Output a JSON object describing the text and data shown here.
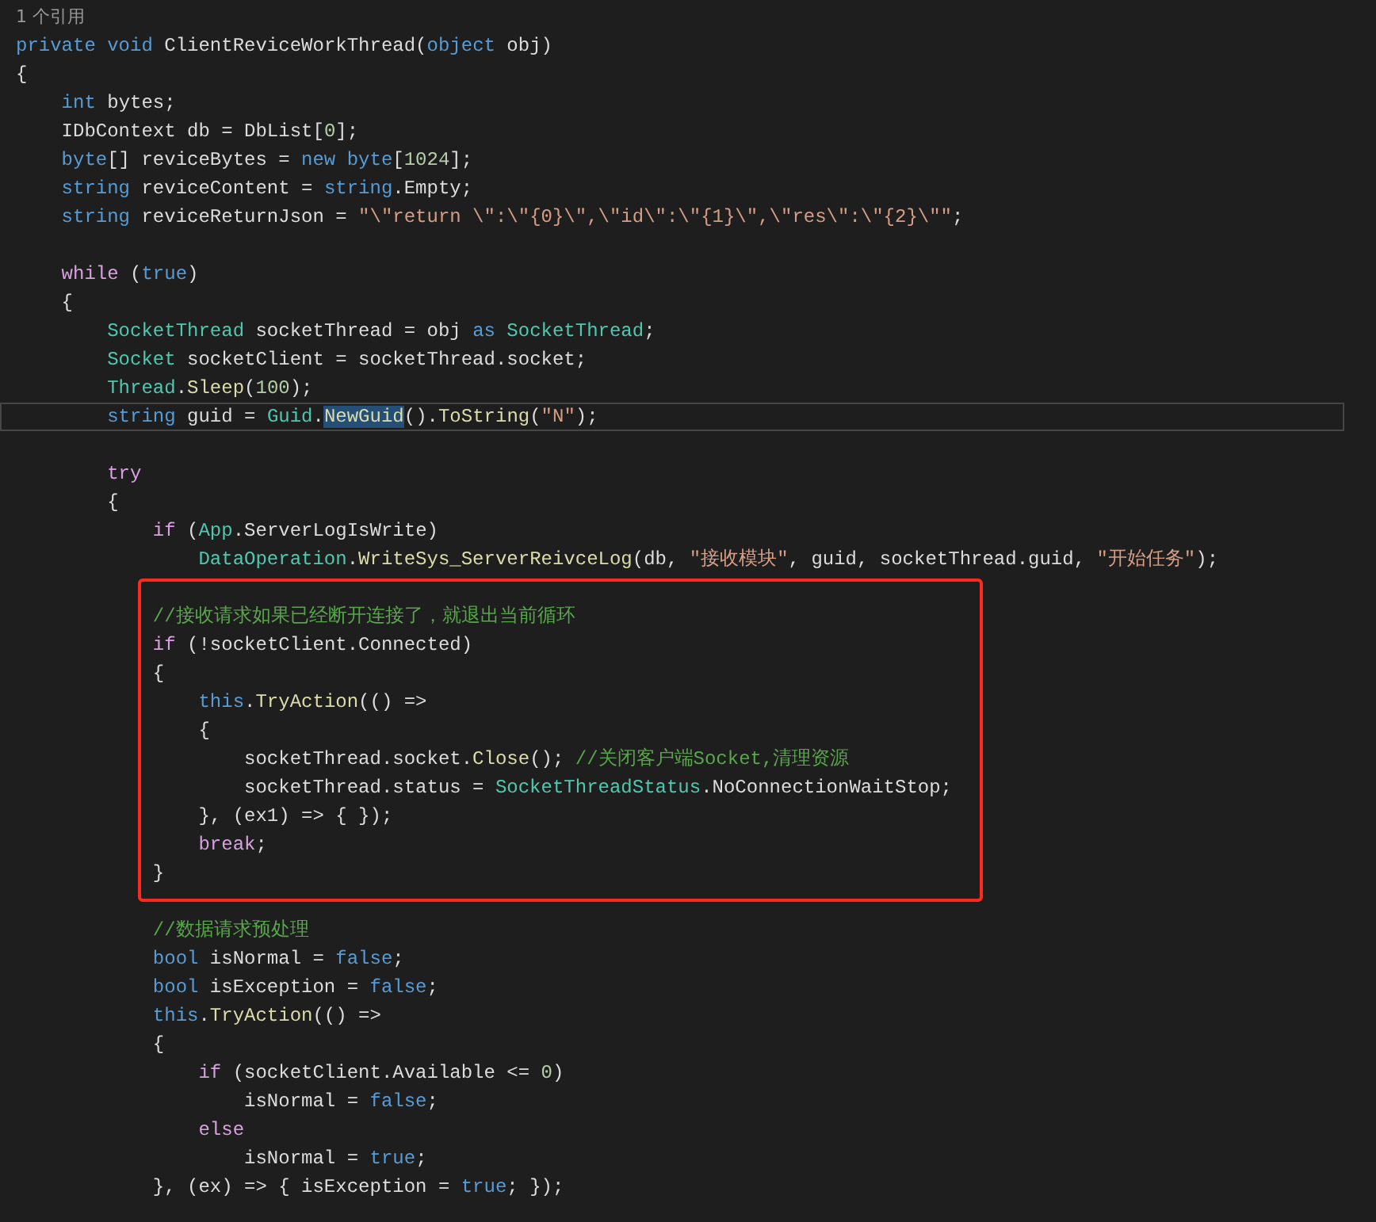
{
  "codelens": "1 个引用",
  "blocks": [
    {
      "framed": false,
      "lines": [
        {
          "kind": "code",
          "tokens": [
            {
              "kind": "kw",
              "text": "private void "
            },
            {
              "kind": "plain",
              "text": "ClientReviceWorkThread("
            },
            {
              "kind": "kw",
              "text": "object"
            },
            {
              "kind": "plain",
              "text": " obj)"
            }
          ]
        },
        {
          "kind": "code",
          "tokens": [
            {
              "kind": "plain",
              "text": "{"
            }
          ]
        },
        {
          "kind": "code",
          "tokens": [
            {
              "kind": "kw",
              "text": "    int"
            },
            {
              "kind": "plain",
              "text": " bytes;"
            }
          ]
        },
        {
          "kind": "code",
          "tokens": [
            {
              "kind": "plain",
              "text": "    IDbContext db = DbList["
            },
            {
              "kind": "num",
              "text": "0"
            },
            {
              "kind": "plain",
              "text": "];"
            }
          ]
        },
        {
          "kind": "code",
          "tokens": [
            {
              "kind": "kw",
              "text": "    byte"
            },
            {
              "kind": "plain",
              "text": "[] reviceBytes = "
            },
            {
              "kind": "kw",
              "text": "new byte"
            },
            {
              "kind": "plain",
              "text": "["
            },
            {
              "kind": "num",
              "text": "1024"
            },
            {
              "kind": "plain",
              "text": "];"
            }
          ]
        },
        {
          "kind": "code",
          "tokens": [
            {
              "kind": "kw",
              "text": "    string"
            },
            {
              "kind": "plain",
              "text": " reviceContent = "
            },
            {
              "kind": "kw",
              "text": "string"
            },
            {
              "kind": "plain",
              "text": ".Empty;"
            }
          ]
        },
        {
          "kind": "code",
          "tokens": [
            {
              "kind": "kw",
              "text": "    string"
            },
            {
              "kind": "plain",
              "text": " reviceReturnJson = "
            },
            {
              "kind": "str",
              "text": "\"\\\"return \\\":\\\"{0}\\\",\\\"id\\\":\\\"{1}\\\",\\\"res\\\":\\\"{2}\\\"\""
            },
            {
              "kind": "plain",
              "text": ";"
            }
          ]
        },
        {
          "kind": "blank"
        },
        {
          "kind": "code",
          "tokens": [
            {
              "kind": "ctl",
              "text": "    while"
            },
            {
              "kind": "plain",
              "text": " ("
            },
            {
              "kind": "kw",
              "text": "true"
            },
            {
              "kind": "plain",
              "text": ")"
            }
          ]
        },
        {
          "kind": "code",
          "tokens": [
            {
              "kind": "plain",
              "text": "    {"
            }
          ]
        },
        {
          "kind": "code",
          "tokens": [
            {
              "kind": "type",
              "text": "        SocketThread"
            },
            {
              "kind": "plain",
              "text": " socketThread = obj "
            },
            {
              "kind": "kw",
              "text": "as "
            },
            {
              "kind": "type",
              "text": "SocketThread"
            },
            {
              "kind": "plain",
              "text": ";"
            }
          ]
        },
        {
          "kind": "code",
          "tokens": [
            {
              "kind": "type",
              "text": "        Socket"
            },
            {
              "kind": "plain",
              "text": " socketClient = socketThread.socket;"
            }
          ]
        },
        {
          "kind": "code",
          "tokens": [
            {
              "kind": "type",
              "text": "        Thread"
            },
            {
              "kind": "plain",
              "text": "."
            },
            {
              "kind": "fn",
              "text": "Sleep"
            },
            {
              "kind": "plain",
              "text": "("
            },
            {
              "kind": "num",
              "text": "100"
            },
            {
              "kind": "plain",
              "text": ");"
            }
          ]
        },
        {
          "kind": "current",
          "tokens": [
            {
              "kind": "kw",
              "text": "        string"
            },
            {
              "kind": "plain",
              "text": " guid = "
            },
            {
              "kind": "type",
              "text": "Guid"
            },
            {
              "kind": "plain",
              "text": "."
            },
            {
              "kind": "selection",
              "text": "NewGuid"
            },
            {
              "kind": "plain",
              "text": "()."
            },
            {
              "kind": "fn",
              "text": "ToString"
            },
            {
              "kind": "plain",
              "text": "("
            },
            {
              "kind": "str",
              "text": "\"N\""
            },
            {
              "kind": "plain",
              "text": ");"
            }
          ]
        },
        {
          "kind": "blank"
        },
        {
          "kind": "code",
          "tokens": [
            {
              "kind": "ctl",
              "text": "        try"
            }
          ]
        },
        {
          "kind": "code",
          "tokens": [
            {
              "kind": "plain",
              "text": "        {"
            }
          ]
        },
        {
          "kind": "code",
          "tokens": [
            {
              "kind": "ctl",
              "text": "            if"
            },
            {
              "kind": "plain",
              "text": " ("
            },
            {
              "kind": "type",
              "text": "App"
            },
            {
              "kind": "plain",
              "text": ".ServerLogIsWrite)"
            }
          ]
        },
        {
          "kind": "code",
          "tokens": [
            {
              "kind": "type",
              "text": "                DataOperation"
            },
            {
              "kind": "plain",
              "text": "."
            },
            {
              "kind": "fn",
              "text": "WriteSys_ServerReivceLog"
            },
            {
              "kind": "plain",
              "text": "(db, "
            },
            {
              "kind": "str",
              "text": "\"接收模块\""
            },
            {
              "kind": "plain",
              "text": ", guid, socketThread.guid, "
            },
            {
              "kind": "str",
              "text": "\"开始任务\""
            },
            {
              "kind": "plain",
              "text": ");"
            }
          ]
        }
      ]
    },
    {
      "framed": true,
      "lines": [
        {
          "kind": "blank"
        },
        {
          "kind": "code",
          "tokens": [
            {
              "kind": "cmt",
              "text": "            //接收请求如果已经断开连接了，就退出当前循环"
            }
          ]
        },
        {
          "kind": "code",
          "tokens": [
            {
              "kind": "ctl",
              "text": "            if"
            },
            {
              "kind": "plain",
              "text": " (!socketClient.Connected)"
            }
          ]
        },
        {
          "kind": "code",
          "tokens": [
            {
              "kind": "plain",
              "text": "            {"
            }
          ]
        },
        {
          "kind": "code",
          "tokens": [
            {
              "kind": "kw",
              "text": "                this"
            },
            {
              "kind": "plain",
              "text": "."
            },
            {
              "kind": "fn",
              "text": "TryAction"
            },
            {
              "kind": "plain",
              "text": "(() =>"
            }
          ]
        },
        {
          "kind": "code",
          "tokens": [
            {
              "kind": "plain",
              "text": "                {"
            }
          ]
        },
        {
          "kind": "code",
          "tokens": [
            {
              "kind": "plain",
              "text": "                    socketThread.socket."
            },
            {
              "kind": "fn",
              "text": "Close"
            },
            {
              "kind": "plain",
              "text": "(); "
            },
            {
              "kind": "cmt",
              "text": "//关闭客户端Socket,清理资源"
            }
          ]
        },
        {
          "kind": "code",
          "tokens": [
            {
              "kind": "plain",
              "text": "                    socketThread.status = "
            },
            {
              "kind": "type",
              "text": "SocketThreadStatus"
            },
            {
              "kind": "plain",
              "text": ".NoConnectionWaitStop;"
            }
          ]
        },
        {
          "kind": "code",
          "tokens": [
            {
              "kind": "plain",
              "text": "                }, (ex1) => { });"
            }
          ]
        },
        {
          "kind": "code",
          "tokens": [
            {
              "kind": "ctl",
              "text": "                break"
            },
            {
              "kind": "plain",
              "text": ";"
            }
          ]
        },
        {
          "kind": "code",
          "tokens": [
            {
              "kind": "plain",
              "text": "            }"
            }
          ]
        }
      ]
    },
    {
      "framed": false,
      "lines": [
        {
          "kind": "blank"
        },
        {
          "kind": "code",
          "tokens": [
            {
              "kind": "cmt",
              "text": "            //数据请求预处理"
            }
          ]
        },
        {
          "kind": "code",
          "tokens": [
            {
              "kind": "kw",
              "text": "            bool"
            },
            {
              "kind": "plain",
              "text": " isNormal = "
            },
            {
              "kind": "kw",
              "text": "false"
            },
            {
              "kind": "plain",
              "text": ";"
            }
          ]
        },
        {
          "kind": "code",
          "tokens": [
            {
              "kind": "kw",
              "text": "            bool"
            },
            {
              "kind": "plain",
              "text": " isException = "
            },
            {
              "kind": "kw",
              "text": "false"
            },
            {
              "kind": "plain",
              "text": ";"
            }
          ]
        },
        {
          "kind": "code",
          "tokens": [
            {
              "kind": "kw",
              "text": "            this"
            },
            {
              "kind": "plain",
              "text": "."
            },
            {
              "kind": "fn",
              "text": "TryAction"
            },
            {
              "kind": "plain",
              "text": "(() =>"
            }
          ]
        },
        {
          "kind": "code",
          "tokens": [
            {
              "kind": "plain",
              "text": "            {"
            }
          ]
        },
        {
          "kind": "code",
          "tokens": [
            {
              "kind": "ctl",
              "text": "                if"
            },
            {
              "kind": "plain",
              "text": " (socketClient.Available <= "
            },
            {
              "kind": "num",
              "text": "0"
            },
            {
              "kind": "plain",
              "text": ")"
            }
          ]
        },
        {
          "kind": "code",
          "tokens": [
            {
              "kind": "plain",
              "text": "                    isNormal = "
            },
            {
              "kind": "kw",
              "text": "false"
            },
            {
              "kind": "plain",
              "text": ";"
            }
          ]
        },
        {
          "kind": "code",
          "tokens": [
            {
              "kind": "ctl",
              "text": "                else"
            }
          ]
        },
        {
          "kind": "code",
          "tokens": [
            {
              "kind": "plain",
              "text": "                    isNormal = "
            },
            {
              "kind": "kw",
              "text": "true"
            },
            {
              "kind": "plain",
              "text": ";"
            }
          ]
        },
        {
          "kind": "code",
          "tokens": [
            {
              "kind": "plain",
              "text": "            }, (ex) => { isException = "
            },
            {
              "kind": "kw",
              "text": "true"
            },
            {
              "kind": "plain",
              "text": "; });"
            }
          ]
        }
      ]
    }
  ]
}
